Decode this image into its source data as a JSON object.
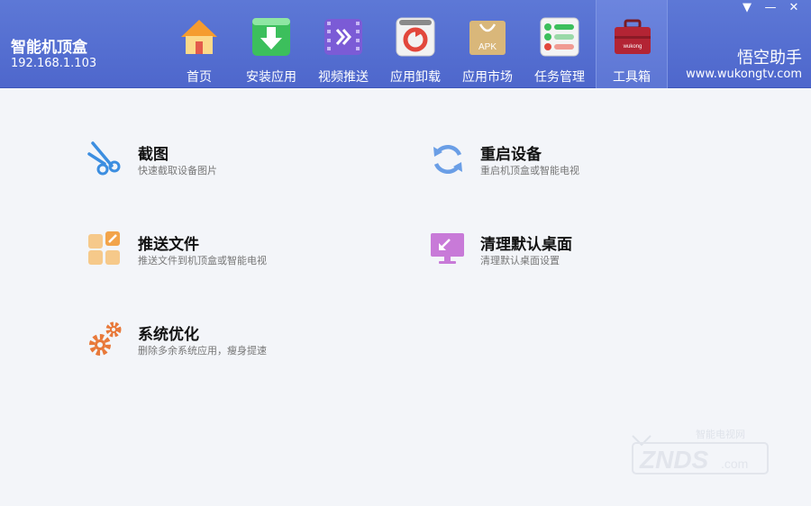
{
  "device": {
    "name": "智能机顶盒",
    "ip": "192.168.1.103"
  },
  "window_controls": {
    "menu": "▼",
    "minimize": "—",
    "close": "✕"
  },
  "nav": {
    "tabs": [
      {
        "label": "首页",
        "icon": "home-icon"
      },
      {
        "label": "安装应用",
        "icon": "install-download-icon"
      },
      {
        "label": "视频推送",
        "icon": "video-push-icon"
      },
      {
        "label": "应用卸载",
        "icon": "uninstall-icon"
      },
      {
        "label": "应用市场",
        "icon": "apk-market-icon"
      },
      {
        "label": "任务管理",
        "icon": "task-manager-icon"
      },
      {
        "label": "工具箱",
        "icon": "toolbox-icon",
        "active": true
      }
    ]
  },
  "brand": {
    "name": "悟空助手",
    "url": "www.wukongtv.com",
    "toolbox_badge": "wukong"
  },
  "tools": [
    {
      "title": "截图",
      "desc": "快速截取设备图片",
      "icon": "scissors-icon",
      "color": "#3c8ee0"
    },
    {
      "title": "重启设备",
      "desc": "重启机顶盒或智能电视",
      "icon": "refresh-icon",
      "color": "#6a9ee6"
    },
    {
      "title": "推送文件",
      "desc": "推送文件到机顶盒或智能电视",
      "icon": "push-file-icon",
      "color": "#f2a44a"
    },
    {
      "title": "清理默认桌面",
      "desc": "清理默认桌面设置",
      "icon": "monitor-icon",
      "color": "#c87ad8"
    },
    {
      "title": "系统优化",
      "desc": "删除多余系统应用，瘦身提速",
      "icon": "gears-icon",
      "color": "#e8793a"
    }
  ],
  "watermark": {
    "text": "ZNDS",
    "sub": "智能电视网",
    "domain": ".com"
  },
  "colors": {
    "header": "#5370d0",
    "background": "#f3f5f9"
  }
}
